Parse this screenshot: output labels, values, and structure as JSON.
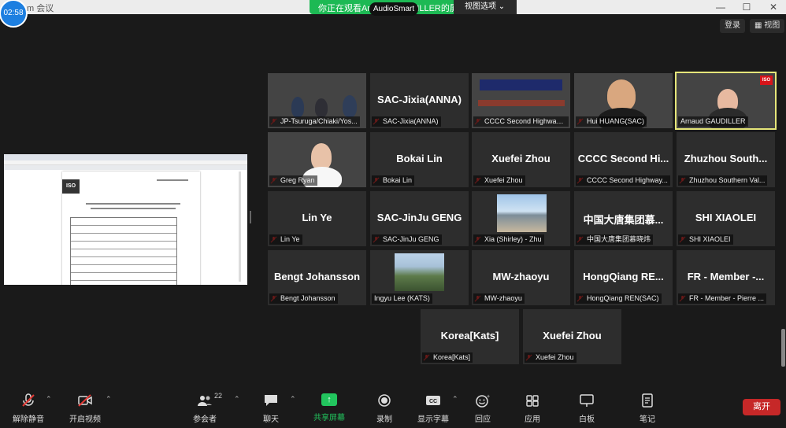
{
  "title_bar": {
    "app_title": "m 会议"
  },
  "meeting_timer": "02:58",
  "share_banner": {
    "text": "你正在观看Arnaud GAUDILLER的屏幕",
    "view_options": "视图选项",
    "audio_badge": "AudioSmart"
  },
  "top_buttons": {
    "login": "登录",
    "view": "视图"
  },
  "participants": [
    {
      "label": "JP-Tsuruga/Chiaki/Yos...",
      "muted": true
    },
    {
      "label": "SAC-Jixia(ANNA)",
      "display_name": "SAC-Jixia(ANNA)",
      "muted": true
    },
    {
      "label": "CCCC Second Highway Co...",
      "muted": true
    },
    {
      "label": "Hui HUANG(SAC)",
      "muted": true
    },
    {
      "label": "Arnaud GAUDILLER",
      "muted": false,
      "active": true
    },
    {
      "label": "Greg Ryan",
      "muted": true
    },
    {
      "label": "Bokai Lin",
      "display_name": "Bokai Lin",
      "muted": true
    },
    {
      "label": "Xuefei Zhou",
      "display_name": "Xuefei Zhou",
      "muted": true
    },
    {
      "label": "CCCC Second Highway...",
      "display_name": "CCCC Second Hi...",
      "muted": true
    },
    {
      "label": "Zhuzhou Southern Val...",
      "display_name": "Zhuzhou South...",
      "muted": true
    },
    {
      "label": "Lin Ye",
      "display_name": "Lin Ye",
      "muted": true
    },
    {
      "label": "SAC-JinJu GENG",
      "display_name": "SAC-JinJu GENG",
      "muted": true
    },
    {
      "label": "Xia (Shirley) - Zhu",
      "muted": true
    },
    {
      "label": "中国大唐集团慕晓炜",
      "display_name": "中国大唐集团慕...",
      "muted": true
    },
    {
      "label": "SHI XIAOLEI",
      "display_name": "SHI XIAOLEI",
      "muted": true
    },
    {
      "label": "Bengt Johansson",
      "display_name": "Bengt Johansson",
      "muted": true
    },
    {
      "label": "Ingyu Lee (KATS)",
      "muted": false
    },
    {
      "label": "MW-zhaoyu",
      "display_name": "MW-zhaoyu",
      "muted": true
    },
    {
      "label": "HongQiang REN(SAC)",
      "display_name": "HongQiang RE...",
      "muted": true
    },
    {
      "label": "FR - Member - Pierre ...",
      "display_name": "FR - Member -...",
      "muted": true
    },
    {
      "label": "Korea[Kats]",
      "display_name": "Korea[Kats]",
      "muted": true
    },
    {
      "label": "Xuefei Zhou",
      "display_name": "Xuefei Zhou",
      "muted": true
    }
  ],
  "toolbar": {
    "unmute": "解除静音",
    "start_video": "开启视频",
    "participants": "参会者",
    "participants_count": "22",
    "chat": "聊天",
    "share_screen": "共享屏幕",
    "record": "录制",
    "captions": "显示字幕",
    "reactions": "回应",
    "apps": "应用",
    "whiteboard": "白板",
    "notes": "笔记",
    "leave": "离开"
  },
  "colors": {
    "share_green": "#1db954",
    "leave_red": "#c62828",
    "active_border": "#e6e67a",
    "muted_red": "#e53935"
  }
}
